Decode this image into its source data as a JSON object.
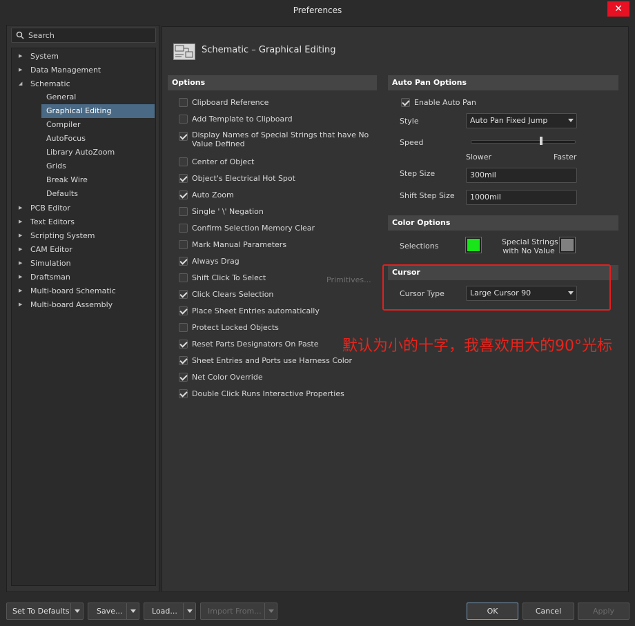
{
  "window": {
    "title": "Preferences",
    "close_glyph": "✕"
  },
  "search": {
    "placeholder": "Search"
  },
  "tree": [
    {
      "label": "System",
      "expanded": false
    },
    {
      "label": "Data Management",
      "expanded": false
    },
    {
      "label": "Schematic",
      "expanded": true,
      "children": [
        "General",
        "Graphical Editing",
        "Compiler",
        "AutoFocus",
        "Library AutoZoom",
        "Grids",
        "Break Wire",
        "Defaults"
      ],
      "selected": "Graphical Editing"
    },
    {
      "label": "PCB Editor",
      "expanded": false
    },
    {
      "label": "Text Editors",
      "expanded": false
    },
    {
      "label": "Scripting System",
      "expanded": false
    },
    {
      "label": "CAM Editor",
      "expanded": false
    },
    {
      "label": "Simulation",
      "expanded": false
    },
    {
      "label": "Draftsman",
      "expanded": false
    },
    {
      "label": "Multi-board Schematic",
      "expanded": false
    },
    {
      "label": "Multi-board Assembly",
      "expanded": false
    }
  ],
  "page": {
    "title": "Schematic – Graphical Editing",
    "icon": "schematic-page-icon"
  },
  "options": {
    "header": "Options",
    "items": [
      {
        "label": "Clipboard Reference",
        "checked": false
      },
      {
        "label": "Add Template to Clipboard",
        "checked": false
      },
      {
        "label": "Display Names of Special Strings that have No Value Defined",
        "checked": true
      },
      {
        "label": "Center of Object",
        "checked": false
      },
      {
        "label": "Object's Electrical Hot Spot",
        "checked": true
      },
      {
        "label": "Auto Zoom",
        "checked": true
      },
      {
        "label": "Single ' \\' Negation",
        "checked": false
      },
      {
        "label": "Confirm Selection Memory Clear",
        "checked": false
      },
      {
        "label": "Mark Manual Parameters",
        "checked": false
      },
      {
        "label": "Always Drag",
        "checked": true
      },
      {
        "label": "Shift Click To Select",
        "checked": false
      },
      {
        "label": "Click Clears Selection",
        "checked": true
      },
      {
        "label": "Place Sheet Entries automatically",
        "checked": true
      },
      {
        "label": "Protect Locked Objects",
        "checked": false
      },
      {
        "label": "Reset Parts Designators On Paste",
        "checked": true
      },
      {
        "label": "Sheet Entries and Ports use Harness Color",
        "checked": true
      },
      {
        "label": "Net Color Override",
        "checked": true
      },
      {
        "label": "Double Click Runs Interactive Properties",
        "checked": true
      }
    ],
    "primitives_label": "Primitives..."
  },
  "auto_pan": {
    "header": "Auto Pan Options",
    "enable_label": "Enable Auto Pan",
    "enable_checked": true,
    "style_label": "Style",
    "style_value": "Auto Pan Fixed Jump",
    "speed_label": "Speed",
    "speed_fraction": 0.66,
    "slower_label": "Slower",
    "faster_label": "Faster",
    "step_size_label": "Step Size",
    "step_size_value": "300mil",
    "shift_step_size_label": "Shift Step Size",
    "shift_step_size_value": "1000mil"
  },
  "color_options": {
    "header": "Color Options",
    "selections_label": "Selections",
    "selections_color": "#19e619",
    "special_strings_label_1": "Special Strings",
    "special_strings_label_2": "with No Value",
    "special_strings_color": "#808080"
  },
  "cursor": {
    "header": "Cursor",
    "type_label": "Cursor Type",
    "type_value": "Large Cursor 90"
  },
  "annotation": {
    "text": "默认为小的十字，我喜欢用大的90°光标",
    "color": "#e8241c"
  },
  "buttons": {
    "set_defaults": "Set To Defaults",
    "save": "Save...",
    "load": "Load...",
    "import_from": "Import From...",
    "ok": "OK",
    "cancel": "Cancel",
    "apply": "Apply"
  }
}
